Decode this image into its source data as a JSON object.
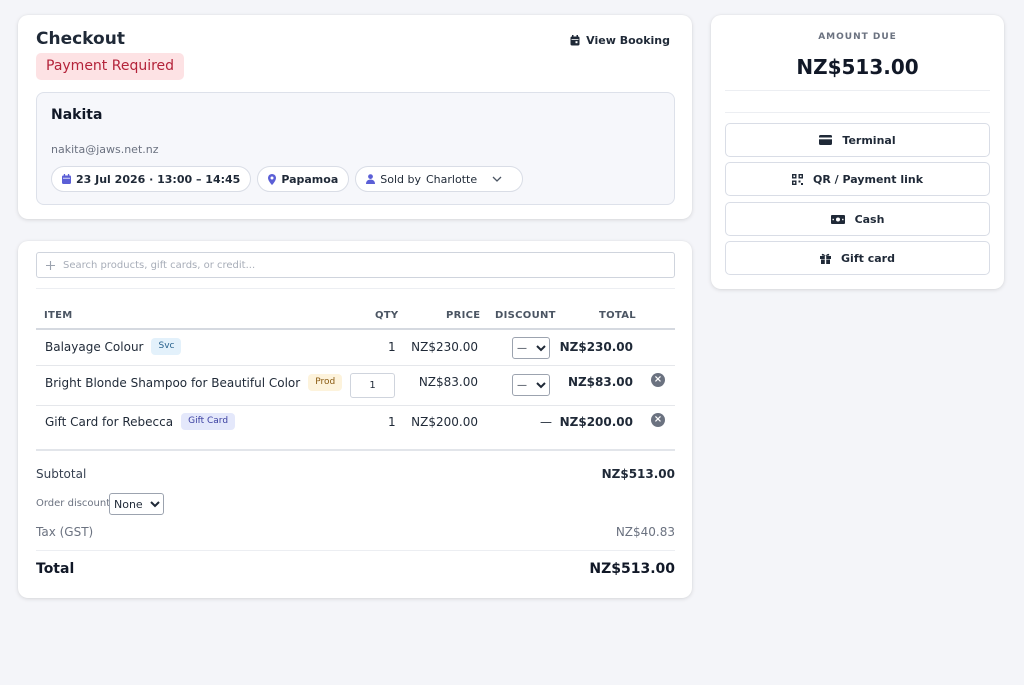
{
  "header": {
    "title": "Checkout",
    "status": "Payment Required",
    "view_booking": "View Booking"
  },
  "customer": {
    "name": "Nakita",
    "email": "nakita@jaws.net.nz",
    "booking_time": "23 Jul 2026 · 13:00 – 14:45",
    "location": "Papamoa",
    "sold_by_label": "Sold by",
    "sold_by_value": "Charlotte"
  },
  "search": {
    "placeholder": "Search products, gift cards, or credit..."
  },
  "table": {
    "headers": {
      "item": "ITEM",
      "qty": "QTY",
      "price": "PRICE",
      "discount": "DISCOUNT",
      "total": "TOTAL"
    },
    "rows": [
      {
        "name": "Balayage Colour",
        "tag": "Svc",
        "qty": "1",
        "price": "NZ$230.00",
        "discount": "—",
        "total": "NZ$230.00"
      },
      {
        "name": "Bright Blonde Shampoo for Beautiful Color",
        "tag": "Prod",
        "qty": "1",
        "price": "NZ$83.00",
        "discount": "—",
        "total": "NZ$83.00"
      },
      {
        "name": "Gift Card for Rebecca",
        "tag": "Gift Card",
        "qty": "1",
        "price": "NZ$200.00",
        "discount": "—",
        "total": "NZ$200.00"
      }
    ]
  },
  "summary": {
    "subtotal_label": "Subtotal",
    "subtotal_value": "NZ$513.00",
    "order_discount_label": "Order discount",
    "order_discount_value": "None",
    "tax_label": "Tax (GST)",
    "tax_value": "NZ$40.83",
    "total_label": "Total",
    "total_value": "NZ$513.00"
  },
  "payment": {
    "amount_due_label": "AMOUNT DUE",
    "amount_due_value": "NZ$513.00",
    "methods": [
      {
        "label": "Terminal",
        "icon": "credit-card-icon"
      },
      {
        "label": "QR / Payment link",
        "icon": "qr-code-icon"
      },
      {
        "label": "Cash",
        "icon": "cash-icon"
      },
      {
        "label": "Gift card",
        "icon": "gift-icon"
      }
    ]
  },
  "colors": {
    "background": "#f4f5f9",
    "status_badge_bg": "#fde2e4",
    "status_badge_text": "#b4233a",
    "accent_icon": "#5b5fd6"
  }
}
